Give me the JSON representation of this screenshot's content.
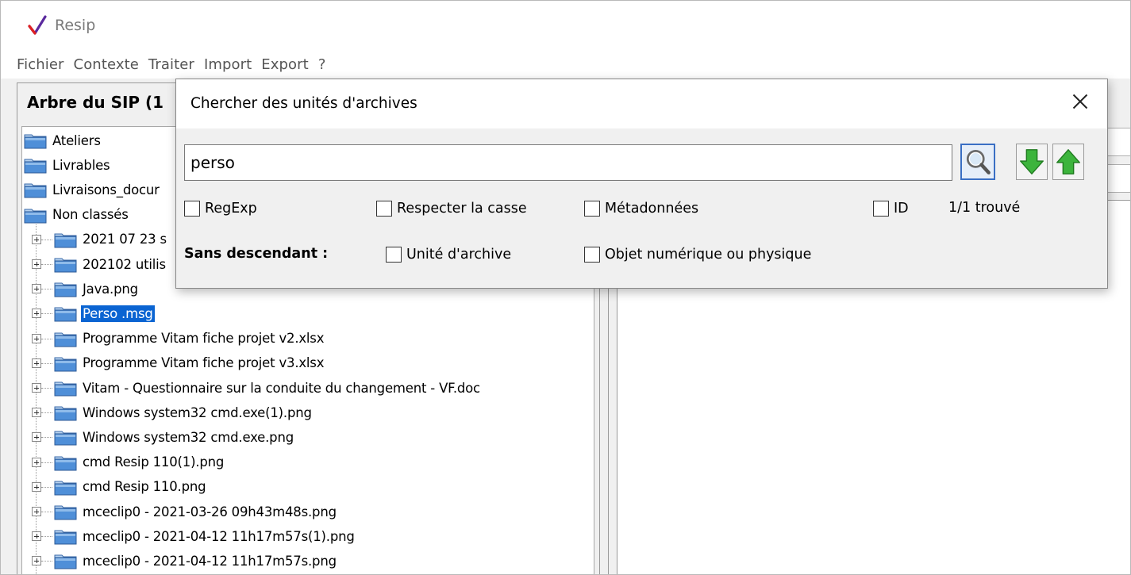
{
  "app": {
    "title": "Resip"
  },
  "menu": [
    "Fichier",
    "Contexte",
    "Traiter",
    "Import",
    "Export",
    "?"
  ],
  "tree": {
    "header": "Arbre du SIP (1",
    "root_items": [
      "Ateliers",
      "Livrables",
      "Livraisons_docur",
      "Non classés"
    ],
    "child_items": [
      "2021 07 23 s",
      "202102 utilis",
      "Java.png",
      "Perso .msg",
      "Programme Vitam fiche projet v2.xlsx",
      "Programme Vitam fiche projet v3.xlsx",
      "Vitam - Questionnaire sur la conduite du changement - VF.doc",
      "Windows system32 cmd.exe(1).png",
      "Windows system32 cmd.exe.png",
      "cmd Resip 110(1).png",
      "cmd Resip 110.png",
      "mceclip0 - 2021-03-26 09h43m48s.png",
      "mceclip0 - 2021-04-12 11h17m57s(1).png",
      "mceclip0 - 2021-04-12 11h17m57s.png"
    ],
    "selected": "Perso .msg"
  },
  "dialog": {
    "title": "Chercher des unités d'archives",
    "search_value": "perso",
    "options": {
      "regexp": "RegExp",
      "case": "Respecter la casse",
      "metadata": "Métadonnées",
      "id": "ID"
    },
    "found": "1/1 trouvé",
    "no_descendant_label": "Sans descendant :",
    "no_descendant_options": {
      "unit": "Unité d'archive",
      "object": "Objet numérique ou physique"
    }
  },
  "colors": {
    "selection": "#0a64d2",
    "folder": "#4f8fd8",
    "arrow_green": "#3cb43c"
  }
}
